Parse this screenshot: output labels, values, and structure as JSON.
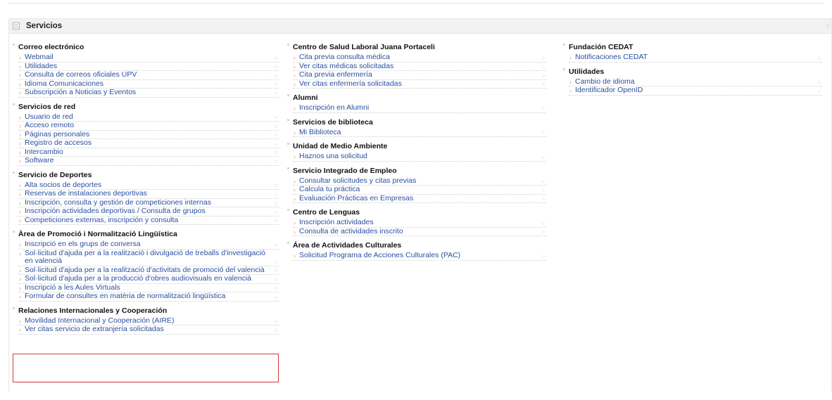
{
  "panel": {
    "title": "Servicios"
  },
  "columns": [
    {
      "groups": [
        {
          "title": "Correo electrónico",
          "items": [
            "Webmail",
            "Utilidades",
            "Consulta de correos oficiales UPV",
            "Idioma Comunicaciones",
            "Subscripción a Noticias y Eventos"
          ]
        },
        {
          "title": "Servicios de red",
          "items": [
            "Usuario de red",
            "Acceso remoto",
            "Páginas personales",
            "Registro de accesos",
            "Intercambio",
            "Software"
          ]
        },
        {
          "title": "Servicio de Deportes",
          "items": [
            "Alta socios de deportes",
            "Reservas de instalaciones deportivas",
            "Inscripción, consulta y gestión de competiciones internas",
            "Inscripción actividades deportivas / Consulta de grupos",
            "Competiciones externas, inscripción y consulta"
          ]
        },
        {
          "title": "Àrea de Promoció i Normalització Lingüística",
          "items": [
            "Inscripció en els grups de conversa",
            "Sol·licitud d'ajuda per a la realització i divulgació de treballs d'investigació en valencià",
            "Sol·licitud d'ajuda per a la realització d'activitats de promoció del valencià",
            "Sol·licitud d'ajuda per a la producció d'obres audiovisuals en valencià",
            "Inscripció a les Aules Virtuals",
            "Formular de consultes en matèria de normalització lingüística"
          ]
        },
        {
          "title": "Relaciones Internacionales y Cooperación",
          "items": [
            "Movilidad Internacional y Cooperación (AIRE)",
            "Ver citas servicio de extranjería solicitadas"
          ]
        }
      ]
    },
    {
      "groups": [
        {
          "title": "Centro de Salud Laboral Juana Portaceli",
          "items": [
            "Cita previa consulta médica",
            "Ver citas médicas solicitadas",
            "Cita previa enfermería",
            "Ver citas enfermería solicitadas"
          ]
        },
        {
          "title": "Alumni",
          "items": [
            "Inscripción en Alumni"
          ]
        },
        {
          "title": "Servicios de biblioteca",
          "items": [
            "Mi Biblioteca"
          ]
        },
        {
          "title": "Unidad de Medio Ambiente",
          "items": [
            "Haznos una solicitud"
          ]
        },
        {
          "title": "Servicio Integrado de Empleo",
          "items": [
            "Consultar solicitudes y citas previas",
            "Calcula tu práctica",
            "Evaluación Prácticas en Empresas"
          ]
        },
        {
          "title": "Centro de Lenguas",
          "items": [
            "Inscripción actividades",
            "Consulta de actividades inscrito"
          ]
        },
        {
          "title": "Área de Actividades Culturales",
          "items": [
            "Solicitud Programa de Acciones Culturales (PAC)"
          ]
        }
      ]
    },
    {
      "groups": [
        {
          "title": "Fundación CEDAT",
          "items": [
            "Notificaciones CEDAT"
          ]
        },
        {
          "title": "Utilidades",
          "items": [
            "Cambio de idioma",
            "Identificador OpenID"
          ]
        }
      ]
    }
  ],
  "colors": {
    "link": "#2a4fa0",
    "bullet": "#e0a070",
    "highlight_border": "#d9343a"
  },
  "icons": {
    "header": "panel-collapse-icon",
    "bullet": "arrow-bullet-icon",
    "go": "go-link-icon"
  }
}
